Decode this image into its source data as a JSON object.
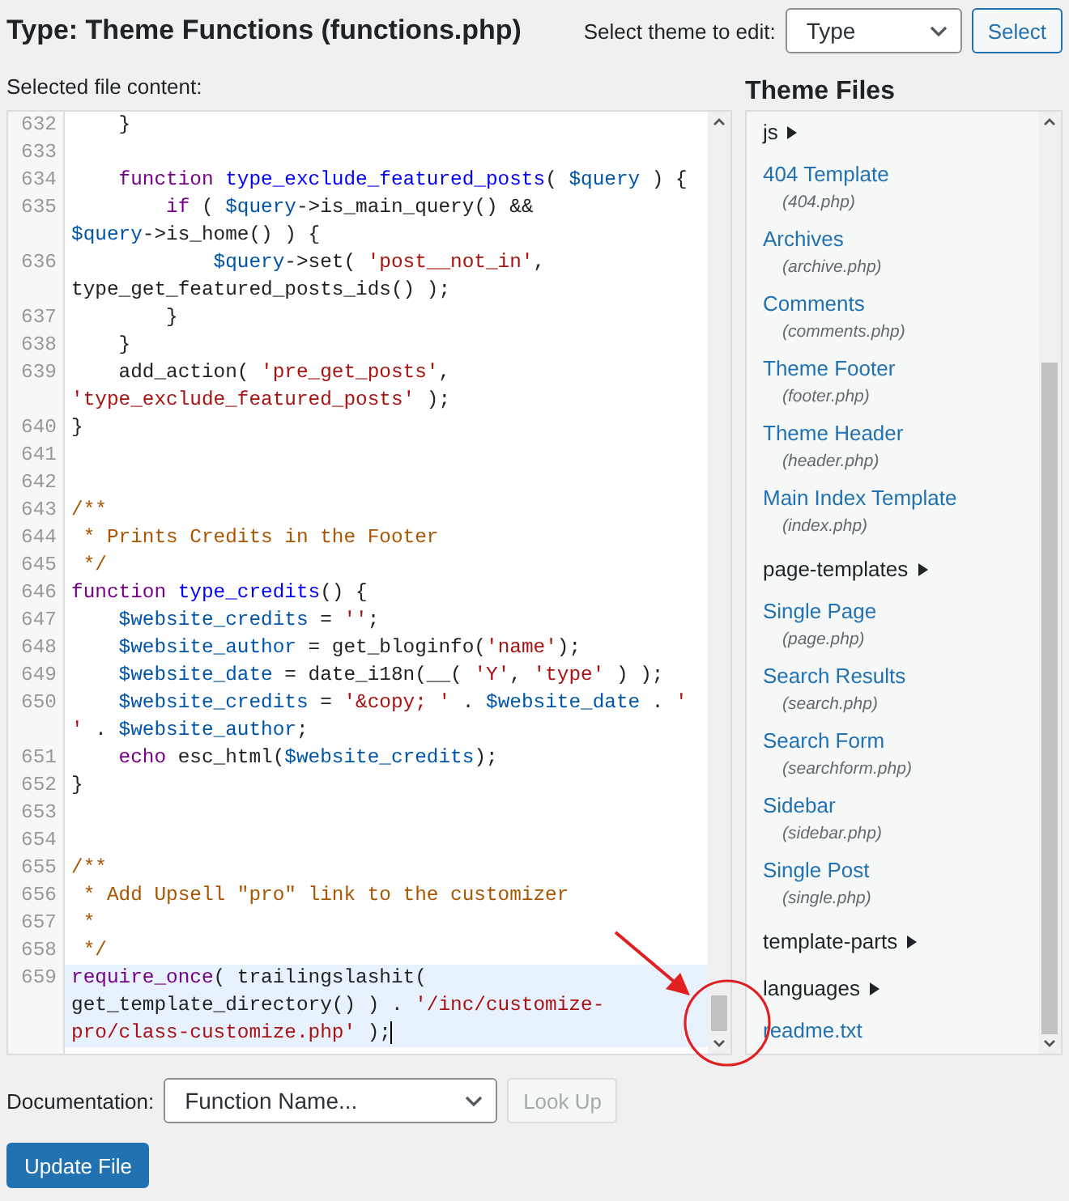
{
  "title": "Type: Theme Functions (functions.php)",
  "theme_select": {
    "label": "Select theme to edit:",
    "value": "Type",
    "button": "Select"
  },
  "editor": {
    "label": "Selected file content:",
    "lines": [
      {
        "number": "632",
        "active": false,
        "rows": [
          {
            "tokens": [
              {
                "kind": "plain",
                "text": "    }"
              }
            ]
          }
        ]
      },
      {
        "number": "633",
        "active": false,
        "rows": [
          {
            "tokens": []
          }
        ]
      },
      {
        "number": "634",
        "active": false,
        "rows": [
          {
            "tokens": [
              {
                "kind": "keyword",
                "text": "    function "
              },
              {
                "kind": "def",
                "text": "type_exclude_featured_posts"
              },
              {
                "kind": "plain",
                "text": "( "
              },
              {
                "kind": "variable",
                "text": "$query"
              },
              {
                "kind": "plain",
                "text": " ) {"
              }
            ]
          }
        ]
      },
      {
        "number": "635",
        "active": false,
        "rows": [
          {
            "tokens": [
              {
                "kind": "keyword",
                "text": "        if"
              },
              {
                "kind": "plain",
                "text": " ( "
              },
              {
                "kind": "variable",
                "text": "$query"
              },
              {
                "kind": "plain",
                "text": "->is_main_query() &&"
              }
            ]
          },
          {
            "tokens": [
              {
                "kind": "variable",
                "text": "$query"
              },
              {
                "kind": "plain",
                "text": "->is_home() ) {"
              }
            ]
          }
        ]
      },
      {
        "number": "636",
        "active": false,
        "rows": [
          {
            "tokens": [
              {
                "kind": "variable",
                "text": "            $query"
              },
              {
                "kind": "plain",
                "text": "->set( "
              },
              {
                "kind": "string",
                "text": "'post__not_in'"
              },
              {
                "kind": "plain",
                "text": ","
              }
            ]
          },
          {
            "tokens": [
              {
                "kind": "plain",
                "text": "type_get_featured_posts_ids() );"
              }
            ]
          }
        ]
      },
      {
        "number": "637",
        "active": false,
        "rows": [
          {
            "tokens": [
              {
                "kind": "plain",
                "text": "        }"
              }
            ]
          }
        ]
      },
      {
        "number": "638",
        "active": false,
        "rows": [
          {
            "tokens": [
              {
                "kind": "plain",
                "text": "    }"
              }
            ]
          }
        ]
      },
      {
        "number": "639",
        "active": false,
        "rows": [
          {
            "tokens": [
              {
                "kind": "plain",
                "text": "    add_action( "
              },
              {
                "kind": "string",
                "text": "'pre_get_posts'"
              },
              {
                "kind": "plain",
                "text": ","
              }
            ]
          },
          {
            "tokens": [
              {
                "kind": "string",
                "text": "'type_exclude_featured_posts'"
              },
              {
                "kind": "plain",
                "text": " );"
              }
            ]
          }
        ]
      },
      {
        "number": "640",
        "active": false,
        "rows": [
          {
            "tokens": [
              {
                "kind": "plain",
                "text": "}"
              }
            ]
          }
        ]
      },
      {
        "number": "641",
        "active": false,
        "rows": [
          {
            "tokens": []
          }
        ]
      },
      {
        "number": "642",
        "active": false,
        "rows": [
          {
            "tokens": []
          }
        ]
      },
      {
        "number": "643",
        "active": false,
        "rows": [
          {
            "tokens": [
              {
                "kind": "comment",
                "text": "/**"
              }
            ]
          }
        ]
      },
      {
        "number": "644",
        "active": false,
        "rows": [
          {
            "tokens": [
              {
                "kind": "comment",
                "text": " * Prints Credits in the Footer"
              }
            ]
          }
        ]
      },
      {
        "number": "645",
        "active": false,
        "rows": [
          {
            "tokens": [
              {
                "kind": "comment",
                "text": " */"
              }
            ]
          }
        ]
      },
      {
        "number": "646",
        "active": false,
        "rows": [
          {
            "tokens": [
              {
                "kind": "keyword",
                "text": "function "
              },
              {
                "kind": "def",
                "text": "type_credits"
              },
              {
                "kind": "plain",
                "text": "() {"
              }
            ]
          }
        ]
      },
      {
        "number": "647",
        "active": false,
        "rows": [
          {
            "tokens": [
              {
                "kind": "variable",
                "text": "    $website_credits"
              },
              {
                "kind": "plain",
                "text": " = "
              },
              {
                "kind": "string",
                "text": "''"
              },
              {
                "kind": "plain",
                "text": ";"
              }
            ]
          }
        ]
      },
      {
        "number": "648",
        "active": false,
        "rows": [
          {
            "tokens": [
              {
                "kind": "variable",
                "text": "    $website_author"
              },
              {
                "kind": "plain",
                "text": " = get_bloginfo("
              },
              {
                "kind": "string",
                "text": "'name'"
              },
              {
                "kind": "plain",
                "text": ");"
              }
            ]
          }
        ]
      },
      {
        "number": "649",
        "active": false,
        "rows": [
          {
            "tokens": [
              {
                "kind": "variable",
                "text": "    $website_date"
              },
              {
                "kind": "plain",
                "text": " = date_i18n(__( "
              },
              {
                "kind": "string",
                "text": "'Y'"
              },
              {
                "kind": "plain",
                "text": ", "
              },
              {
                "kind": "string",
                "text": "'type'"
              },
              {
                "kind": "plain",
                "text": " ) );"
              }
            ]
          }
        ]
      },
      {
        "number": "650",
        "active": false,
        "rows": [
          {
            "tokens": [
              {
                "kind": "variable",
                "text": "    $website_credits"
              },
              {
                "kind": "plain",
                "text": " = "
              },
              {
                "kind": "string",
                "text": "'&copy; '"
              },
              {
                "kind": "plain",
                "text": " . "
              },
              {
                "kind": "variable",
                "text": "$website_date"
              },
              {
                "kind": "plain",
                "text": " . "
              },
              {
                "kind": "string",
                "text": "'"
              }
            ]
          },
          {
            "tokens": [
              {
                "kind": "string",
                "text": "'"
              },
              {
                "kind": "plain",
                "text": " . "
              },
              {
                "kind": "variable",
                "text": "$website_author"
              },
              {
                "kind": "plain",
                "text": ";"
              }
            ]
          }
        ]
      },
      {
        "number": "651",
        "active": false,
        "rows": [
          {
            "tokens": [
              {
                "kind": "keyword",
                "text": "    echo"
              },
              {
                "kind": "plain",
                "text": " esc_html("
              },
              {
                "kind": "variable",
                "text": "$website_credits"
              },
              {
                "kind": "plain",
                "text": ");"
              }
            ]
          }
        ]
      },
      {
        "number": "652",
        "active": false,
        "rows": [
          {
            "tokens": [
              {
                "kind": "plain",
                "text": "}"
              }
            ]
          }
        ]
      },
      {
        "number": "653",
        "active": false,
        "rows": [
          {
            "tokens": []
          }
        ]
      },
      {
        "number": "654",
        "active": false,
        "rows": [
          {
            "tokens": []
          }
        ]
      },
      {
        "number": "655",
        "active": false,
        "rows": [
          {
            "tokens": [
              {
                "kind": "comment",
                "text": "/**"
              }
            ]
          }
        ]
      },
      {
        "number": "656",
        "active": false,
        "rows": [
          {
            "tokens": [
              {
                "kind": "comment",
                "text": " * Add Upsell \"pro\" link to the customizer"
              }
            ]
          }
        ]
      },
      {
        "number": "657",
        "active": false,
        "rows": [
          {
            "tokens": [
              {
                "kind": "comment",
                "text": " *"
              }
            ]
          }
        ]
      },
      {
        "number": "658",
        "active": false,
        "rows": [
          {
            "tokens": [
              {
                "kind": "comment",
                "text": " */"
              }
            ]
          }
        ]
      },
      {
        "number": "659",
        "active": true,
        "rows": [
          {
            "tokens": [
              {
                "kind": "keyword",
                "text": "require_once"
              },
              {
                "kind": "plain",
                "text": "( trailingslashit("
              }
            ]
          },
          {
            "tokens": [
              {
                "kind": "plain",
                "text": "get_template_directory() ) . "
              },
              {
                "kind": "string",
                "text": "'/inc/customize-"
              }
            ]
          },
          {
            "tokens": [
              {
                "kind": "string",
                "text": "pro/class-customize.php'"
              },
              {
                "kind": "plain",
                "text": " );"
              }
            ]
          }
        ]
      }
    ]
  },
  "theme_files": {
    "heading": "Theme Files",
    "items": [
      {
        "kind": "folder",
        "name": "js",
        "expanded": false
      },
      {
        "kind": "template",
        "name": "404 Template",
        "file": "(404.php)"
      },
      {
        "kind": "template",
        "name": "Archives",
        "file": "(archive.php)"
      },
      {
        "kind": "template",
        "name": "Comments",
        "file": "(comments.php)"
      },
      {
        "kind": "template",
        "name": "Theme Footer",
        "file": "(footer.php)"
      },
      {
        "kind": "template",
        "name": "Theme Header",
        "file": "(header.php)"
      },
      {
        "kind": "template",
        "name": "Main Index Template",
        "file": "(index.php)"
      },
      {
        "kind": "folder",
        "name": "page-templates",
        "expanded": false
      },
      {
        "kind": "template",
        "name": "Single Page",
        "file": "(page.php)"
      },
      {
        "kind": "template",
        "name": "Search Results",
        "file": "(search.php)"
      },
      {
        "kind": "template",
        "name": "Search Form",
        "file": "(searchform.php)"
      },
      {
        "kind": "template",
        "name": "Sidebar",
        "file": "(sidebar.php)"
      },
      {
        "kind": "template",
        "name": "Single Post",
        "file": "(single.php)"
      },
      {
        "kind": "folder",
        "name": "template-parts",
        "expanded": false
      },
      {
        "kind": "folder",
        "name": "languages",
        "expanded": false
      },
      {
        "kind": "file",
        "name": "readme.txt"
      }
    ]
  },
  "documentation": {
    "label": "Documentation:",
    "value": "Function Name...",
    "button": "Look Up"
  },
  "update_button": "Update File"
}
